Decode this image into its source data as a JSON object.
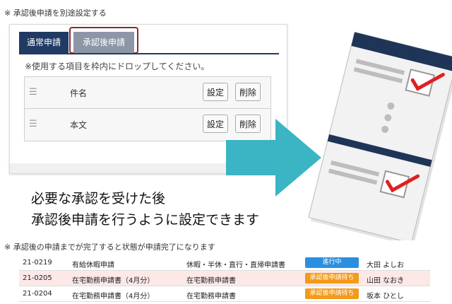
{
  "note_top": "※ 承認後申請を別途設定する",
  "note_bottom": "※ 承認後の申請までが完了すると状態が申請完了になります",
  "tabs": [
    {
      "label": "通常申請"
    },
    {
      "label": "承認後申請"
    }
  ],
  "drop_instruction": "※使用する項目を枠内にドロップしてください。",
  "items": [
    {
      "label": "件名",
      "set": "設定",
      "delete": "削除"
    },
    {
      "label": "本文",
      "set": "設定",
      "delete": "削除"
    }
  ],
  "caption_line1": "必要な承認を受けた後",
  "caption_line2": "承認後申請を行うように設定できます",
  "table_rows": [
    {
      "id": "21-0219",
      "title": "有給休暇申請",
      "type": "休暇・半休・直行・直帰申請書",
      "status": "進行中",
      "user": "大田 よしお"
    },
    {
      "id": "21-0205",
      "title": "在宅勤務申請書（4月分）",
      "type": "在宅勤務申請書",
      "status": "承認後申請待ち",
      "user": "山田 なおき"
    },
    {
      "id": "21-0204",
      "title": "在宅勤務申請書（4月分）",
      "type": "在宅勤務申請書",
      "status": "承認後申請待ち",
      "user": "坂本 ひとし"
    }
  ],
  "colors": {
    "tab_active": "#203b63",
    "tab_inactive": "#8c96a6",
    "highlight_border": "#8b2a32",
    "arrow": "#3bb4c3",
    "status_progress": "#2a8fe0",
    "status_waiting": "#f29a1a",
    "row_highlight": "#fde8e8"
  }
}
